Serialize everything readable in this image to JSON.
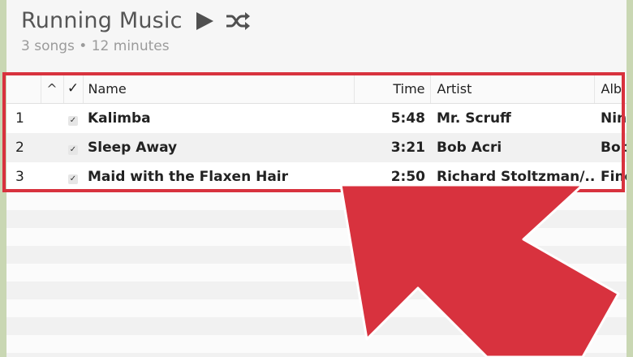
{
  "playlist": {
    "title": "Running Music",
    "summary": "3 songs • 12 minutes",
    "play_icon": "play-icon",
    "shuffle_icon": "shuffle-icon"
  },
  "columns": {
    "sort_indicator": "^",
    "checked": "✓",
    "name": "Name",
    "time": "Time",
    "artist": "Artist",
    "album": "Alb"
  },
  "tracks": [
    {
      "number": "1",
      "checked": "✓",
      "name": "Kalimba",
      "time": "5:48",
      "artist": "Mr. Scruff",
      "album": "Nin"
    },
    {
      "number": "2",
      "checked": "✓",
      "name": "Sleep Away",
      "time": "3:21",
      "artist": "Bob Acri",
      "album": "Bob"
    },
    {
      "number": "3",
      "checked": "✓",
      "name": "Maid with the Flaxen Hair",
      "time": "2:50",
      "artist": "Richard Stoltzman/...",
      "album": "Fine"
    }
  ],
  "colors": {
    "annotation_red": "#d8323e",
    "background_green": "#c9d7b3"
  }
}
